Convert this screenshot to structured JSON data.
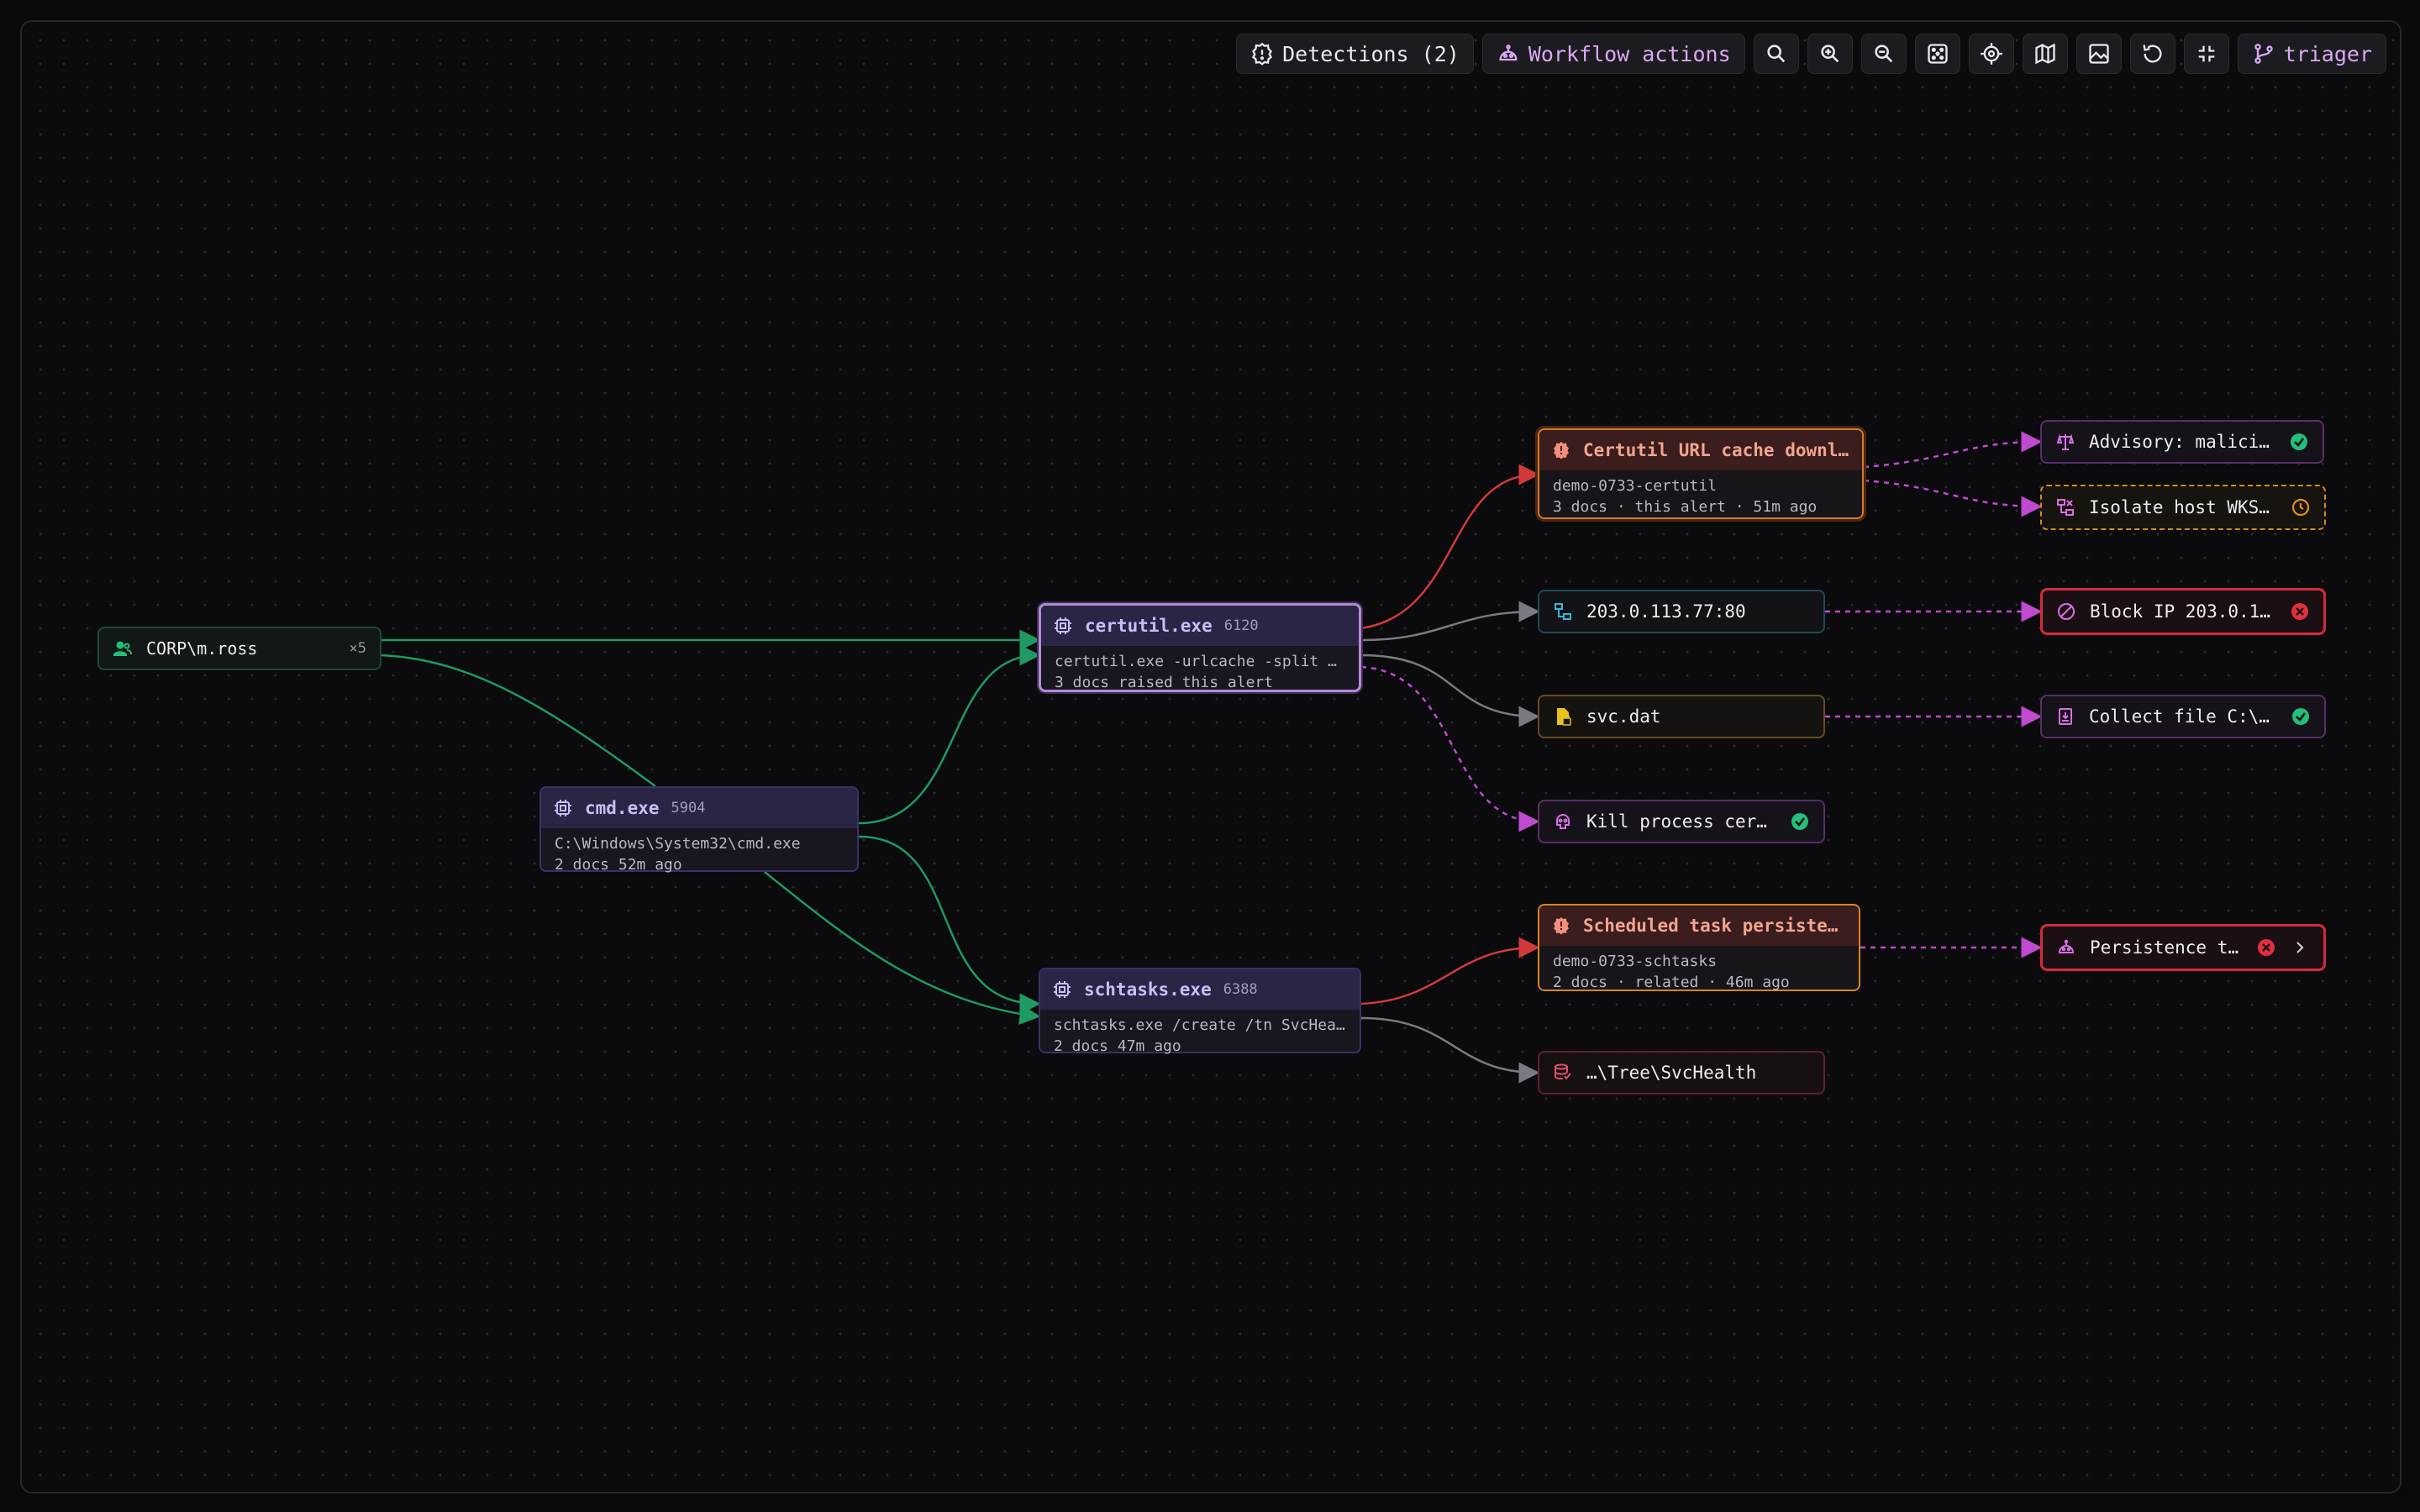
{
  "toolbar": {
    "detections_label": "Detections (2)",
    "workflow_label": "Workflow actions",
    "user_label": "triager",
    "icon_buttons": [
      "search-icon",
      "zoom-in-icon",
      "zoom-out-icon",
      "fit-view-icon",
      "recenter-icon",
      "minimap-icon",
      "export-image-icon",
      "refresh-icon",
      "collapse-icon"
    ]
  },
  "nodes": {
    "user": {
      "label": "CORP\\m.ross",
      "count": "×5"
    },
    "cmd": {
      "name": "cmd.exe",
      "pid": "5904",
      "cmdline": "C:\\Windows\\System32\\cmd.exe",
      "meta": "2 docs 52m ago"
    },
    "certutil": {
      "name": "certutil.exe",
      "pid": "6120",
      "cmdline": "certutil.exe -urlcache -split -…",
      "meta": "3 docs raised this alert"
    },
    "schtasks": {
      "name": "schtasks.exe",
      "pid": "6388",
      "cmdline": "schtasks.exe /create /tn SvcHea…",
      "meta": "2 docs 47m ago"
    },
    "alert_certutil": {
      "title": "Certutil URL cache downlo…",
      "rule": "demo-0733-certutil",
      "meta": "3 docs · this alert · 51m ago"
    },
    "alert_schtasks": {
      "title": "Scheduled task persistenc…",
      "rule": "demo-0733-schtasks",
      "meta": "2 docs · related · 46m ago"
    },
    "ip": {
      "label": "203.0.113.77:80"
    },
    "file": {
      "label": "svc.dat"
    },
    "kill": {
      "label": "Kill process certu…",
      "status": "success"
    },
    "registry": {
      "label": "…\\Tree\\SvcHealth"
    },
    "advisory": {
      "label": "Advisory: maliciou…",
      "status": "success"
    },
    "isolate": {
      "label": "Isolate host WKS-0…",
      "status": "pending"
    },
    "block_ip": {
      "label": "Block IP 203.0.113…",
      "status": "failed"
    },
    "collect": {
      "label": "Collect file C:\\Us…",
      "status": "success"
    },
    "persistence": {
      "label": "Persistence tri…",
      "status": "failed"
    }
  },
  "colors": {
    "process_edge": "#1f9a63",
    "alert_edge": "#d23a3a",
    "artifact_edge": "#6a6a72",
    "action_edge": "#c04ad0",
    "success": "#22c07a",
    "failed": "#e0303e",
    "pending": "#e0901e"
  }
}
